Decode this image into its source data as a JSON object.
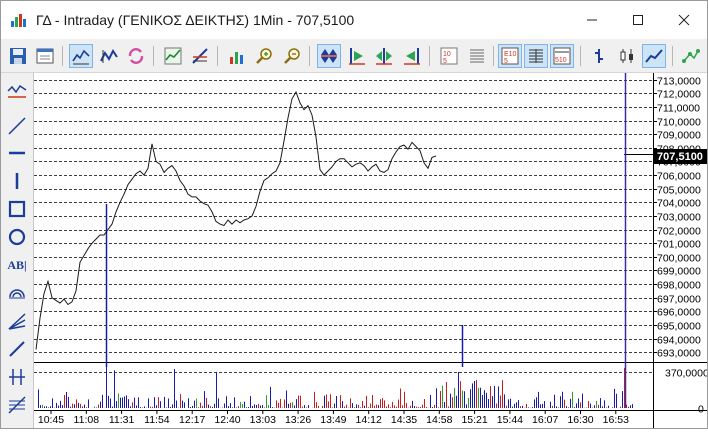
{
  "window": {
    "title": "ΓΔ - Intraday (ΓΕΝΙΚΟΣ ΔΕΙΚΤΗΣ) 1Min - 707,5100"
  },
  "toolbar": {
    "buttons": [
      {
        "name": "save-icon"
      },
      {
        "name": "properties-icon"
      },
      {
        "name": "line-chart-mode-icon"
      },
      {
        "name": "ohlc-mode-icon"
      },
      {
        "name": "refresh-icon"
      },
      {
        "name": "trend-chart-icon"
      },
      {
        "name": "chart-tool-icon"
      },
      {
        "name": "bar-volume-icon"
      },
      {
        "name": "zoom-in-icon"
      },
      {
        "name": "zoom-out-icon"
      },
      {
        "name": "scroll-both-icon"
      },
      {
        "name": "scroll-start-icon"
      },
      {
        "name": "scroll-center-icon"
      },
      {
        "name": "scroll-end-icon"
      },
      {
        "name": "trades-icon"
      },
      {
        "name": "grid-icon"
      },
      {
        "name": "depth-icon"
      },
      {
        "name": "level-icon"
      },
      {
        "name": "depth-510-icon"
      },
      {
        "name": "bar-icon"
      },
      {
        "name": "candle-icon"
      },
      {
        "name": "line-icon"
      },
      {
        "name": "indicator-icon"
      }
    ]
  },
  "left_tools": [
    {
      "name": "indicator-tool-icon"
    },
    {
      "name": "trendline-tool-icon"
    },
    {
      "name": "horizontal-line-tool-icon"
    },
    {
      "name": "vertical-line-tool-icon"
    },
    {
      "name": "rectangle-tool-icon"
    },
    {
      "name": "ellipse-tool-icon"
    },
    {
      "name": "text-tool-icon",
      "label": "AB|"
    },
    {
      "name": "arc-tool-icon"
    },
    {
      "name": "fan-tool-icon"
    },
    {
      "name": "line-tool-icon"
    },
    {
      "name": "cross-tool-icon"
    },
    {
      "name": "fibonacci-tool-icon"
    }
  ],
  "chart_data": {
    "type": "line",
    "price": {
      "last_label": "707,5100",
      "ylim": [
        692.5,
        713.2
      ],
      "ticks": [
        "713,0000",
        "712,0000",
        "711,0000",
        "710,0000",
        "709,0000",
        "708,0000",
        "707,0000",
        "706,0000",
        "705,0000",
        "704,0000",
        "703,0000",
        "702,0000",
        "701,0000",
        "700,0000",
        "699,0000",
        "698,0000",
        "697,0000",
        "696,0000",
        "695,0000",
        "694,0000",
        "693,0000"
      ],
      "tick_values": [
        713,
        712,
        711,
        710,
        709,
        708,
        707,
        706,
        705,
        704,
        703,
        702,
        701,
        700,
        699,
        698,
        697,
        696,
        695,
        694,
        693
      ],
      "series_x": [
        0,
        4,
        8,
        12,
        16,
        20,
        24,
        28,
        32,
        36,
        40,
        44,
        48,
        52,
        56,
        60,
        64,
        68,
        72,
        76,
        80,
        84,
        88,
        92,
        96,
        100,
        104,
        108,
        112,
        116,
        120,
        124,
        128,
        132,
        136,
        140,
        144,
        148,
        152,
        156,
        160,
        164,
        168,
        172,
        176,
        180,
        184,
        188,
        192,
        196,
        200,
        204,
        208,
        212,
        216,
        220,
        224,
        228,
        232,
        236,
        240,
        244,
        248,
        252,
        256,
        260,
        264,
        268,
        272,
        276,
        280,
        284,
        288,
        292,
        296,
        300,
        304,
        308,
        312,
        316,
        320,
        324,
        328,
        332,
        336,
        340,
        344,
        348,
        352,
        356,
        360,
        364,
        368,
        372,
        376,
        380,
        384,
        388,
        392,
        396,
        400,
        404,
        408,
        412,
        416,
        420,
        424,
        428,
        432,
        436,
        440,
        444,
        448,
        452,
        456,
        460,
        464,
        468,
        472,
        476,
        480,
        484,
        488,
        492,
        496,
        500,
        504,
        508,
        512,
        516,
        520,
        524,
        528,
        532,
        536,
        540,
        544,
        548,
        552,
        556,
        560,
        564,
        568,
        572,
        576,
        580,
        584,
        588
      ],
      "series_y": [
        693.2,
        695.5,
        697.3,
        698.2,
        697.0,
        696.8,
        696.6,
        696.9,
        696.5,
        696.7,
        697.5,
        699.6,
        700.1,
        700.6,
        701.0,
        701.3,
        701.6,
        701.6,
        702.0,
        702.4,
        703.3,
        704.0,
        704.6,
        705.3,
        705.7,
        706.1,
        706.3,
        706.0,
        706.5,
        708.3,
        707.0,
        706.8,
        706.2,
        706.5,
        706.7,
        706.3,
        705.6,
        705.2,
        704.6,
        704.4,
        704.4,
        704.1,
        703.9,
        703.8,
        703.3,
        702.6,
        702.4,
        702.3,
        702.7,
        702.4,
        702.7,
        702.5,
        702.7,
        702.8,
        703.0,
        703.7,
        704.8,
        705.6,
        705.8,
        706.1,
        706.3,
        706.9,
        708.5,
        710.2,
        711.6,
        712.1,
        711.3,
        710.8,
        711.1,
        710.4,
        708.8,
        706.4,
        706.0,
        706.3,
        706.6,
        707.0,
        707.2,
        707.2,
        706.9,
        706.6,
        706.8,
        706.9,
        706.7,
        706.3,
        706.6,
        706.8,
        706.3,
        706.2,
        706.4,
        707.2,
        707.7,
        708.1,
        708.2,
        707.9,
        708.4,
        708.1,
        707.8,
        706.9,
        706.5,
        707.3,
        707.4
      ],
      "reference_line": 707.51
    },
    "volume": {
      "ylim": [
        0,
        420000
      ],
      "ticks": [
        "370,0000",
        "0"
      ],
      "tick_values": [
        370000,
        0
      ]
    },
    "x_ticks": [
      "10:45",
      "11:08",
      "11:31",
      "11:54",
      "12:17",
      "12:40",
      "13:03",
      "13:26",
      "13:49",
      "14:12",
      "14:35",
      "14:58",
      "15:21",
      "15:44",
      "16:07",
      "16:30",
      "16:53"
    ],
    "colors": {
      "price_line": "#1a1a1a",
      "grid": "#000000",
      "vol_up": "#1a1aa8",
      "vol_down": "#c81e1e",
      "vol_neutral": "#2e9e2e",
      "cursor": "#3a2ea0"
    }
  }
}
